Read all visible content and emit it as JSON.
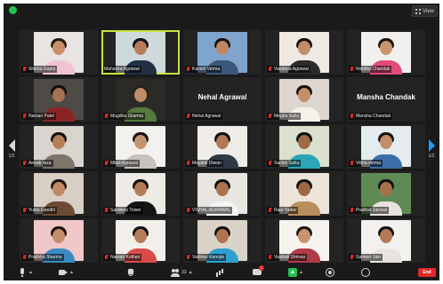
{
  "topbar": {
    "view_label": "View"
  },
  "nav": {
    "left_page": "1/2",
    "right_page": "1/2"
  },
  "participants": [
    {
      "name": "Shikha Gupta",
      "muted": true,
      "kind": "video",
      "bg": "#e8e4e2",
      "skin": "#c8906a",
      "hair": "#2b1a12",
      "shirt": "#f0c4d4"
    },
    {
      "name": "Mahavira Agrawal",
      "muted": false,
      "speaking": true,
      "kind": "video",
      "bg": "#cfd9dc",
      "skin": "#b87c5a",
      "hair": "#141414",
      "shirt": "#223044"
    },
    {
      "name": "Kanish Verma",
      "muted": true,
      "kind": "video",
      "bg": "#7fa5cf",
      "skin": "#c08862",
      "hair": "#1a1410",
      "shirt": "#3c5878"
    },
    {
      "name": "Vandana Agrawal",
      "muted": true,
      "kind": "video",
      "bg": "#efe9e4",
      "skin": "#c38d69",
      "hair": "#161010",
      "shirt": "#2c2c2c"
    },
    {
      "name": "Nishtha Chandak",
      "muted": true,
      "kind": "video",
      "bg": "#f2f0ee",
      "skin": "#c99571",
      "hair": "#1e1410",
      "shirt": "#e34b7a"
    },
    {
      "name": "Naman Patel",
      "muted": true,
      "kind": "video",
      "bg": "#4e4a46",
      "skin": "#a7704e",
      "hair": "#121010",
      "shirt": "#8a2424"
    },
    {
      "name": "Mugdha Sharma",
      "muted": true,
      "kind": "photo",
      "bg": "#2c2a26",
      "skin": "#c08c66",
      "hair": "#2a2014",
      "shirt": "#557a3c"
    },
    {
      "name": "Nehal Agrawal",
      "muted": true,
      "kind": "name",
      "big_name": "Nehal Agrawal"
    },
    {
      "name": "Megha Sahu",
      "muted": true,
      "kind": "video",
      "bg": "#ddd6d0",
      "skin": "#c48e68",
      "hair": "#1a120e",
      "shirt": "#f5f0ea"
    },
    {
      "name": "Mansha Chandak",
      "muted": true,
      "kind": "name",
      "big_name": "Mansha Chandak"
    },
    {
      "name": "Anoab raza",
      "muted": true,
      "kind": "video",
      "bg": "#d9d4cd",
      "skin": "#b67e58",
      "hair": "#161210",
      "shirt": "#7c7468"
    },
    {
      "name": "Mitali Agrawal",
      "muted": true,
      "kind": "video",
      "bg": "#f3f1ee",
      "skin": "#c79470",
      "hair": "#1a1210",
      "shirt": "#c6c2bc"
    },
    {
      "name": "Mayank Diwan",
      "muted": true,
      "kind": "video",
      "bg": "#f0ede9",
      "skin": "#b27a54",
      "hair": "#121010",
      "shirt": "#2d3a46"
    },
    {
      "name": "Sachin Sahu",
      "muted": true,
      "kind": "video",
      "bg": "#dbe0cf",
      "skin": "#a06a48",
      "hair": "#101010",
      "shirt": "#2aa6b8"
    },
    {
      "name": "Vibha verma",
      "muted": true,
      "kind": "video",
      "bg": "#e4ecf0",
      "skin": "#c38e6a",
      "hair": "#1a1410",
      "shirt": "#3c6fa8"
    },
    {
      "name": "Yukta Gandhi",
      "muted": true,
      "kind": "video",
      "bg": "#d8cfc4",
      "skin": "#c08a66",
      "hair": "#1e1612",
      "shirt": "#6b4b34"
    },
    {
      "name": "Sandeep Tolani",
      "muted": true,
      "kind": "video",
      "bg": "#eeebe6",
      "skin": "#b47c56",
      "hair": "#141010",
      "shirt": "#141414"
    },
    {
      "name": "VISHAL AGRAWAL",
      "muted": true,
      "kind": "video",
      "bg": "#e9e6e2",
      "skin": "#aa744e",
      "hair": "#121010",
      "shirt": "#f5f5f5"
    },
    {
      "name": "Raja Yadav",
      "muted": true,
      "kind": "video",
      "bg": "#ece4d8",
      "skin": "#9e6846",
      "hair": "#101010",
      "shirt": "#b88f5c"
    },
    {
      "name": "Prabhat Jaiswal",
      "muted": true,
      "kind": "video",
      "bg": "#5f8a56",
      "skin": "#a8714e",
      "hair": "#121010",
      "shirt": "#e7e3dc"
    },
    {
      "name": "Pratibha Sharma",
      "muted": true,
      "kind": "video",
      "bg": "#f1c7c7",
      "skin": "#c58e6a",
      "hair": "#1a1210",
      "shirt": "#3a8ac0"
    },
    {
      "name": "Naman Kothari",
      "muted": true,
      "kind": "video",
      "bg": "#f2efea",
      "skin": "#b47e58",
      "hair": "#121010",
      "shirt": "#d94b4b"
    },
    {
      "name": "Vaibhav Kanojia",
      "muted": true,
      "kind": "video",
      "bg": "#dad3c9",
      "skin": "#ad7550",
      "hair": "#141010",
      "shirt": "#30a0d0"
    },
    {
      "name": "Vaishali Shrivas",
      "muted": true,
      "kind": "video",
      "bg": "#f6f3ef",
      "skin": "#c9936e",
      "hair": "#1c1410",
      "shirt": "#b03a48"
    },
    {
      "name": "Sameer Jain",
      "muted": true,
      "kind": "video",
      "bg": "#f3f1ed",
      "skin": "#b27b56",
      "hair": "#121010",
      "shirt": "#e8e4dd"
    }
  ],
  "toolbar": {
    "participants_count": "33",
    "chat_badge": "1",
    "end_label": "End"
  }
}
